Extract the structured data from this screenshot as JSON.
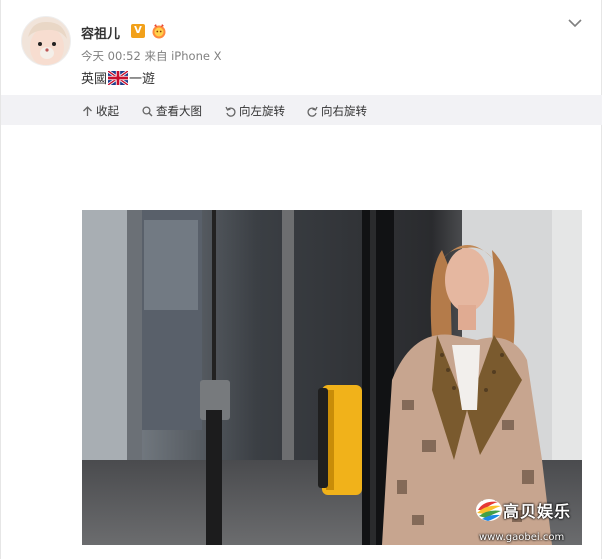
{
  "post": {
    "username": "容祖儿",
    "verified_badge": "V",
    "medal_icon": "fan-medal-icon",
    "time": "今天 00:52",
    "source": "来自 iPhone X",
    "content_before_flag": "英國",
    "content_after_flag": "一遊",
    "flag_icon": "uk-flag-icon"
  },
  "toolbar": {
    "collapse": "收起",
    "view_large": "查看大图",
    "rotate_left": "向左旋转",
    "rotate_right": "向右旋转"
  },
  "watermark": {
    "brand": "高贝娱乐",
    "url": "www.gaobei.com"
  },
  "colors": {
    "badge": "#f2a11a",
    "toolbar_bg": "#f2f2f5",
    "meta_text": "#808080"
  }
}
